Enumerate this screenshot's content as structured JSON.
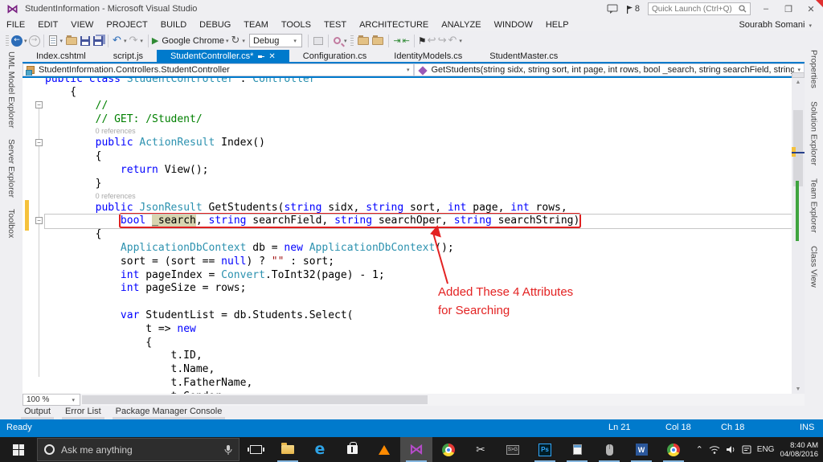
{
  "window": {
    "title": "StudentInformation - Microsoft Visual Studio",
    "user": "Sourabh Somani",
    "notification_count": "8",
    "quick_launch_placeholder": "Quick Launch (Ctrl+Q)"
  },
  "menubar": {
    "items": [
      "FILE",
      "EDIT",
      "VIEW",
      "PROJECT",
      "BUILD",
      "DEBUG",
      "TEAM",
      "TOOLS",
      "TEST",
      "ARCHITECTURE",
      "ANALYZE",
      "WINDOW",
      "HELP"
    ]
  },
  "toolbar": {
    "browser": "Google Chrome",
    "configuration": "Debug"
  },
  "tabs": [
    {
      "label": "Index.cshtml",
      "active": false
    },
    {
      "label": "script.js",
      "active": false
    },
    {
      "label": "StudentController.cs*",
      "active": true
    },
    {
      "label": "Configuration.cs",
      "active": false
    },
    {
      "label": "IdentityModels.cs",
      "active": false
    },
    {
      "label": "StudentMaster.cs",
      "active": false
    }
  ],
  "navbar": {
    "type_dropdown": "StudentInformation.Controllers.StudentController",
    "member_dropdown": "GetStudents(string sidx, string sort, int page, int rows, bool _search, string searchField, string searchOper, string search"
  },
  "left_panel_tabs": [
    "UML Model Explorer",
    "Server Explorer",
    "Toolbox"
  ],
  "right_panel_tabs": [
    "Properties",
    "Solution Explorer",
    "Team Explorer",
    "Class View"
  ],
  "editor": {
    "zoom_level": "100 %",
    "codelens_label": "0 references",
    "annotation": {
      "line1": "Added These 4 Attributes",
      "line2": "for Searching"
    },
    "lines": [
      {
        "t": "clip",
        "tokens": [
          [
            "k",
            "public class "
          ],
          [
            "t",
            "StudentController"
          ],
          [
            "p",
            " : "
          ],
          [
            "t",
            "Controller"
          ]
        ]
      },
      {
        "t": "code",
        "tokens": [
          [
            "p",
            "    {"
          ]
        ]
      },
      {
        "t": "code",
        "tokens": [
          [
            "c",
            "        //"
          ]
        ]
      },
      {
        "t": "code",
        "tokens": [
          [
            "c",
            "        // GET: /Student/"
          ]
        ]
      },
      {
        "t": "lens",
        "indent": 8,
        "text": "0 references"
      },
      {
        "t": "code",
        "tokens": [
          [
            "k",
            "        public "
          ],
          [
            "t",
            "ActionResult"
          ],
          [
            "p",
            " Index()"
          ]
        ]
      },
      {
        "t": "code",
        "tokens": [
          [
            "p",
            "        {"
          ]
        ]
      },
      {
        "t": "code",
        "tokens": [
          [
            "k",
            "            return"
          ],
          [
            "p",
            " View();"
          ]
        ]
      },
      {
        "t": "code",
        "tokens": [
          [
            "p",
            "        }"
          ]
        ]
      },
      {
        "t": "lens",
        "indent": 8,
        "text": "0 references"
      },
      {
        "t": "code",
        "tokens": [
          [
            "k",
            "        public "
          ],
          [
            "t",
            "JsonResult"
          ],
          [
            "p",
            " GetStudents("
          ],
          [
            "k",
            "string"
          ],
          [
            "p",
            " sidx, "
          ],
          [
            "k",
            "string"
          ],
          [
            "p",
            " sort, "
          ],
          [
            "k",
            "int"
          ],
          [
            "p",
            " page, "
          ],
          [
            "k",
            "int"
          ],
          [
            "p",
            " rows,"
          ]
        ]
      },
      {
        "t": "code",
        "cls": "current-line",
        "pre": "            ",
        "box": true,
        "tokens": [
          [
            "k",
            "bool"
          ],
          [
            "p",
            " "
          ],
          [
            "hl",
            "_search"
          ],
          [
            "p",
            ", "
          ],
          [
            "k",
            "string"
          ],
          [
            "p",
            " searchField, "
          ],
          [
            "k",
            "string"
          ],
          [
            "p",
            " searchOper, "
          ],
          [
            "k",
            "string"
          ],
          [
            "p",
            " searchString)"
          ]
        ]
      },
      {
        "t": "code",
        "tokens": [
          [
            "p",
            "        {"
          ]
        ]
      },
      {
        "t": "code",
        "tokens": [
          [
            "t",
            "            ApplicationDbContext"
          ],
          [
            "p",
            " db = "
          ],
          [
            "k",
            "new"
          ],
          [
            "p",
            " "
          ],
          [
            "t",
            "ApplicationDbContext"
          ],
          [
            "p",
            "();"
          ]
        ]
      },
      {
        "t": "code",
        "tokens": [
          [
            "p",
            "            sort = (sort == "
          ],
          [
            "k",
            "null"
          ],
          [
            "p",
            ") ? "
          ],
          [
            "s",
            "\"\""
          ],
          [
            "p",
            " : sort;"
          ]
        ]
      },
      {
        "t": "code",
        "tokens": [
          [
            "k",
            "            int"
          ],
          [
            "p",
            " pageIndex = "
          ],
          [
            "t",
            "Convert"
          ],
          [
            "p",
            ".ToInt32(page) - 1;"
          ]
        ]
      },
      {
        "t": "code",
        "tokens": [
          [
            "k",
            "            int"
          ],
          [
            "p",
            " pageSize = rows;"
          ]
        ]
      },
      {
        "t": "blank"
      },
      {
        "t": "code",
        "tokens": [
          [
            "k",
            "            var"
          ],
          [
            "p",
            " StudentList = db.Students.Select("
          ]
        ]
      },
      {
        "t": "code",
        "tokens": [
          [
            "p",
            "                t => "
          ],
          [
            "k",
            "new"
          ]
        ]
      },
      {
        "t": "code",
        "tokens": [
          [
            "p",
            "                {"
          ]
        ]
      },
      {
        "t": "code",
        "tokens": [
          [
            "p",
            "                    t.ID,"
          ]
        ]
      },
      {
        "t": "code",
        "tokens": [
          [
            "p",
            "                    t.Name,"
          ]
        ]
      },
      {
        "t": "code",
        "tokens": [
          [
            "p",
            "                    t.FatherName,"
          ]
        ]
      },
      {
        "t": "code",
        "tokens": [
          [
            "p",
            "                    t.Gender,"
          ]
        ]
      }
    ]
  },
  "bottom_tabs": [
    "Output",
    "Error List",
    "Package Manager Console"
  ],
  "statusbar": {
    "state": "Ready",
    "ln": "Ln 21",
    "col": "Col 18",
    "ch": "Ch 18",
    "ins": "INS"
  },
  "taskbar": {
    "search_placeholder": "Ask me anything",
    "apps": [
      "task-view",
      "file-explorer",
      "edge",
      "store",
      "vlc",
      "visual-studio",
      "chrome",
      "snipping-tool",
      "screen-to-gif",
      "photoshop",
      "notepad",
      "mouse-settings",
      "word",
      "chrome"
    ],
    "tray_icons": [
      "hidden-icons-chevron",
      "wifi-icon",
      "volume-icon",
      "action-center-icon"
    ],
    "language": "ENG",
    "time": "8:40 AM",
    "date": "04/08/2016"
  },
  "colors": {
    "accent": "#007ACC",
    "annotation_red": "#E32222",
    "keyword": "#0000FF",
    "type": "#2B91AF",
    "comment": "#008000"
  }
}
